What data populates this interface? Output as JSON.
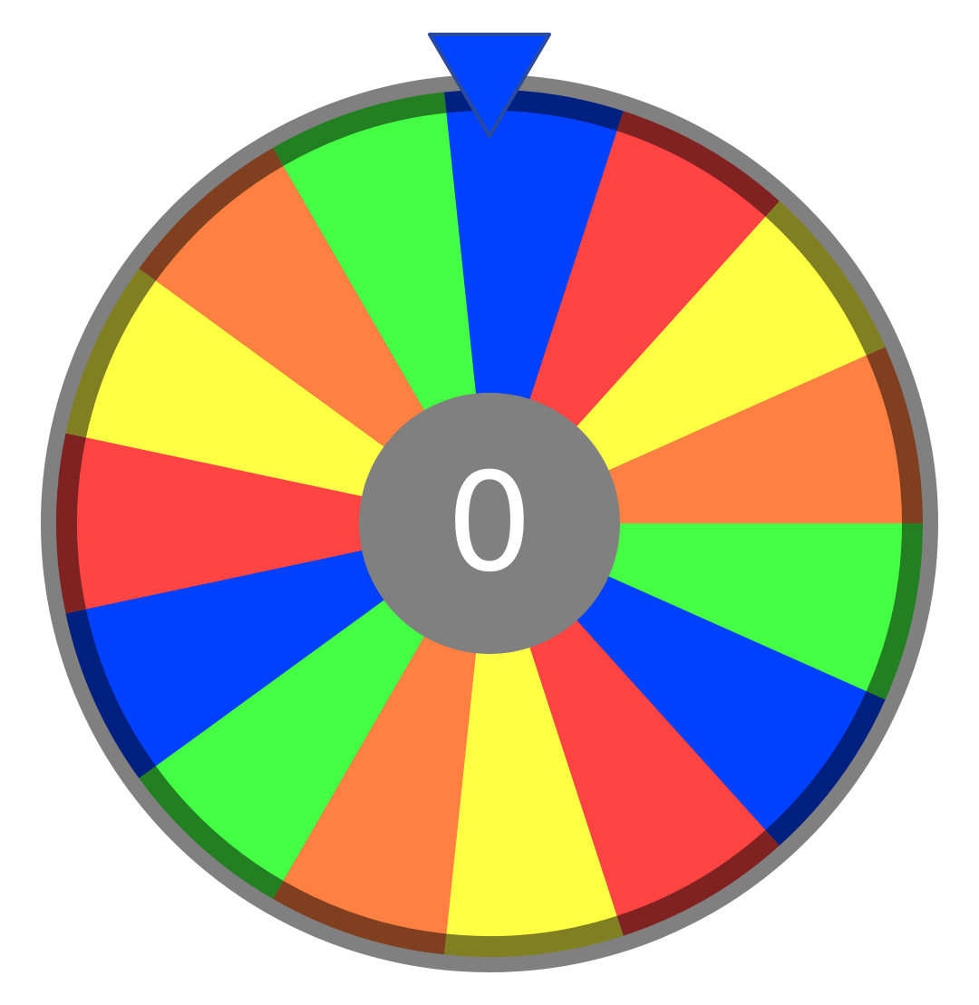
{
  "wheel": {
    "score": "0",
    "segment_colors": [
      "#0040ff",
      "#ff4444",
      "#ffff44",
      "#ff8040",
      "#44ff44",
      "#0040ff",
      "#ff4444",
      "#ffff44",
      "#ff8040",
      "#44ff44",
      "#0040ff",
      "#ff4444",
      "#ffff44",
      "#ff8040",
      "#44ff44"
    ],
    "segment_rim_colors": [
      "#002080",
      "#802222",
      "#808022",
      "#804020",
      "#228022",
      "#002080",
      "#802222",
      "#808022",
      "#804020",
      "#228022",
      "#002080",
      "#802222",
      "#808022",
      "#804020",
      "#228022"
    ],
    "outer_ring_color": "#808080",
    "hub_color": "#808080",
    "pointer_color": "#0044ff",
    "pointer_border_color": "#2a4aa0"
  }
}
